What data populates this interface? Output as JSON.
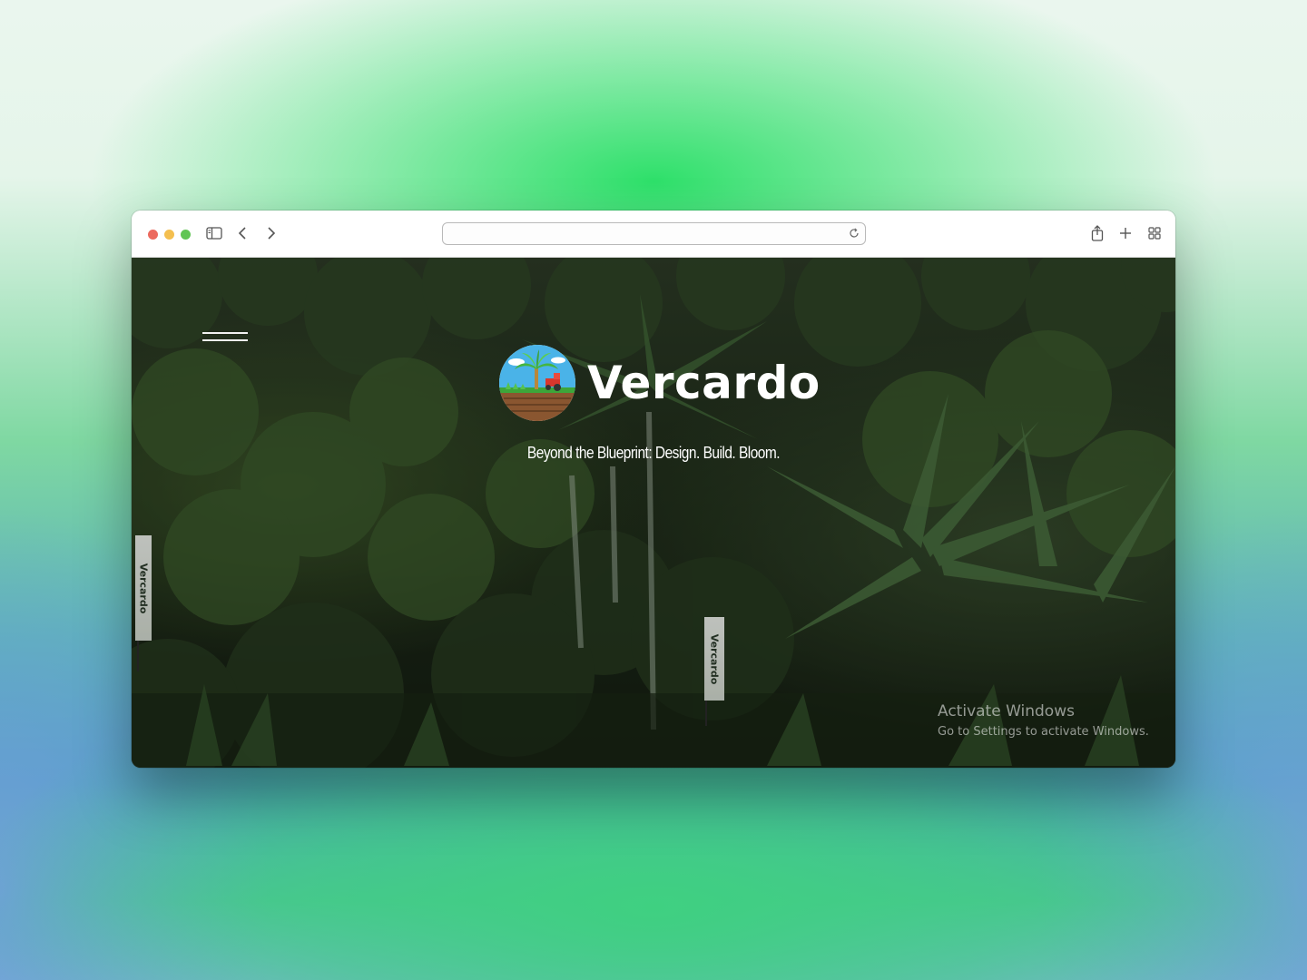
{
  "browser": {
    "url": "",
    "toolbar_icons": [
      "sidebar-icon",
      "back-icon",
      "forward-icon",
      "reload-icon",
      "share-icon",
      "new-tab-icon",
      "tab-overview-icon"
    ]
  },
  "site": {
    "brand_name": "Vercardo",
    "tagline": "Beyond the Blueprint: Design. Build. Bloom.",
    "banner_text": "Vercardo",
    "logo": "palm-tree-tractor-logo"
  },
  "watermark": {
    "title": "Activate Windows",
    "subtitle": "Go to Settings to activate Windows."
  },
  "colors": {
    "traffic_red": "#ec6a5e",
    "traffic_yellow": "#f4bf4f",
    "traffic_green": "#61c554",
    "background_green": "#2ee06a",
    "foliage_dark": "#1b2817"
  }
}
